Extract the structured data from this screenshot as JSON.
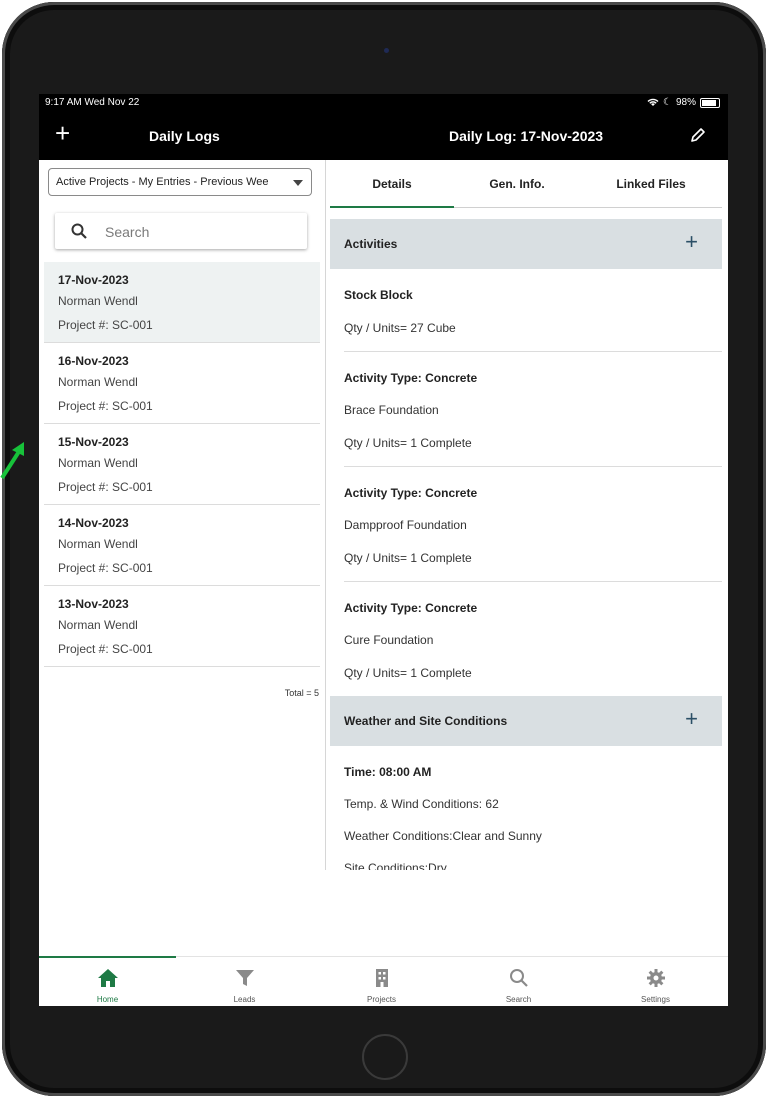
{
  "status": {
    "time": "9:17 AM  Wed Nov 22",
    "battery": "98%"
  },
  "header": {
    "left_title": "Daily Logs",
    "right_title": "Daily Log: 17-Nov-2023"
  },
  "filter": {
    "selected": "Active Projects - My Entries - Previous Wee"
  },
  "search": {
    "placeholder": "Search"
  },
  "logs": [
    {
      "date": "17-Nov-2023",
      "name": "Norman Wendl",
      "project": "Project #: SC-001"
    },
    {
      "date": "16-Nov-2023",
      "name": "Norman Wendl",
      "project": "Project #: SC-001"
    },
    {
      "date": "15-Nov-2023",
      "name": "Norman Wendl",
      "project": "Project #: SC-001"
    },
    {
      "date": "14-Nov-2023",
      "name": "Norman Wendl",
      "project": "Project #: SC-001"
    },
    {
      "date": "13-Nov-2023",
      "name": "Norman Wendl",
      "project": "Project #: SC-001"
    }
  ],
  "total": "Total = 5",
  "tabs": [
    "Details",
    "Gen. Info.",
    "Linked Files"
  ],
  "activities": {
    "header": "Activities",
    "stock": {
      "title": "Stock Block",
      "qty": "Qty / Units= 27 Cube"
    },
    "items": [
      {
        "type": "Activity Type:  Concrete",
        "desc": "Brace Foundation",
        "qty": "Qty / Units= 1 Complete"
      },
      {
        "type": "Activity Type:  Concrete",
        "desc": "Dampproof Foundation",
        "qty": "Qty / Units= 1 Complete"
      },
      {
        "type": "Activity Type:  Concrete",
        "desc": "Cure Foundation",
        "qty": "Qty / Units= 1 Complete"
      }
    ]
  },
  "weather": {
    "header": "Weather and Site Conditions",
    "time": "Time: 08:00 AM",
    "temp": "Temp. & Wind Conditions: 62",
    "conditions": "Weather Conditions:Clear and Sunny",
    "site": "Site Conditions:Dry"
  },
  "tabbar": [
    {
      "label": "Home",
      "icon": "home-icon"
    },
    {
      "label": "Leads",
      "icon": "filter-icon"
    },
    {
      "label": "Projects",
      "icon": "building-icon"
    },
    {
      "label": "Search",
      "icon": "search-icon"
    },
    {
      "label": "Settings",
      "icon": "gear-icon"
    }
  ],
  "colors": {
    "accent": "#1e7a45",
    "section_bg": "#d9dfe2",
    "selected_row": "#eef2f2"
  }
}
